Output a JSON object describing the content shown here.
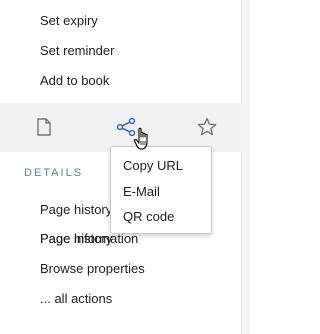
{
  "menu": {
    "items": [
      {
        "label": "Set expiry"
      },
      {
        "label": "Set reminder"
      },
      {
        "label": "Add to book"
      }
    ]
  },
  "toolbar": {
    "icons": [
      "page-icon",
      "share-icon",
      "star-icon"
    ],
    "accent_color": "#72777d"
  },
  "share_menu": {
    "items": [
      {
        "label": "Copy URL"
      },
      {
        "label": "E-Mail"
      },
      {
        "label": "QR code"
      }
    ]
  },
  "details": {
    "heading": "DETAILS",
    "items": [
      {
        "label": "Page history"
      },
      {
        "label": "Page information"
      },
      {
        "label": "Browse properties"
      },
      {
        "label": "... all actions"
      }
    ]
  }
}
